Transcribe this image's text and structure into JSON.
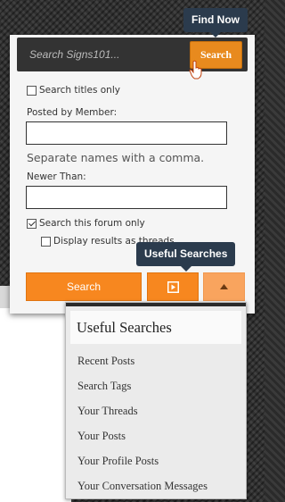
{
  "tooltips": {
    "find_now": "Find Now",
    "useful_searches": "Useful Searches"
  },
  "search_bar": {
    "placeholder": "Search Signs101...",
    "button_label": "Search"
  },
  "options": {
    "search_titles_only": "Search titles only",
    "posted_by_member_label": "Posted by Member:",
    "posted_by_member_hint": "Separate names with a comma.",
    "newer_than_label": "Newer Than:",
    "search_this_forum_only": "Search this forum only",
    "display_results_as_threads": "Display results as threads"
  },
  "buttons": {
    "search": "Search"
  },
  "useful_searches": {
    "title": "Useful Searches",
    "items": [
      "Recent Posts",
      "Search Tags",
      "Your Threads",
      "Your Posts",
      "Your Profile Posts",
      "Your Conversation Messages"
    ]
  },
  "colors": {
    "accent": "#f7871f",
    "tooltip": "#2b3b4d"
  }
}
